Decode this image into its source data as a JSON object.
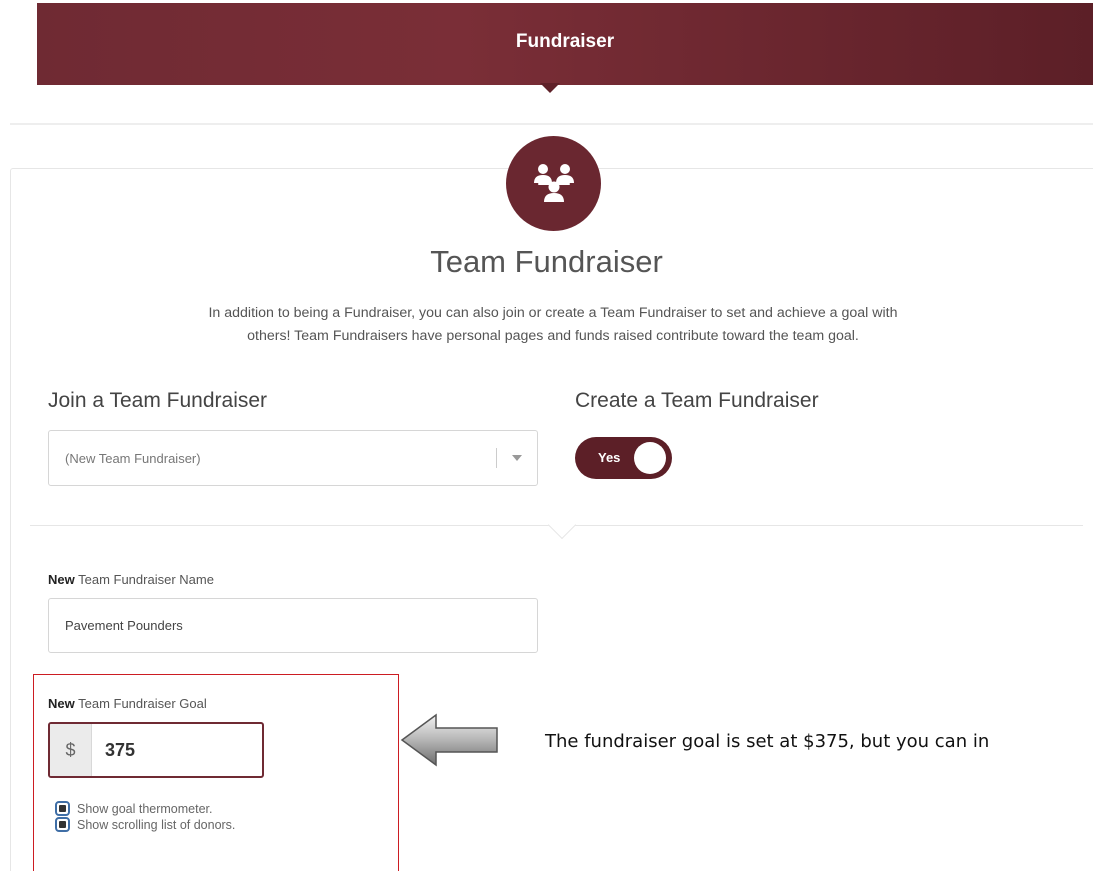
{
  "header": {
    "title": "Fundraiser"
  },
  "team": {
    "icon": "team-group-icon",
    "title": "Team Fundraiser",
    "intro_line1": "In addition to being a Fundraiser, you can also join or create a Team Fundraiser to set and achieve a goal with",
    "intro_line2": "others! Team Fundraisers have personal pages and funds raised contribute toward the team goal."
  },
  "join": {
    "heading": "Join a Team Fundraiser",
    "select_value": "(New Team Fundraiser)"
  },
  "create": {
    "heading": "Create a Team Fundraiser",
    "toggle_label": "Yes"
  },
  "name_field": {
    "label_bold": "New",
    "label_rest": " Team Fundraiser Name",
    "value": "Pavement Pounders"
  },
  "goal_field": {
    "label_bold": "New",
    "label_rest": " Team Fundraiser Goal",
    "prefix": "$",
    "value": "375"
  },
  "options": [
    {
      "label": "Show goal thermometer."
    },
    {
      "label": "Show scrolling list of donors."
    }
  ],
  "annotation": {
    "callout": "The fundraiser goal is set at $375, but you can in"
  },
  "colors": {
    "brand": "#6f2a33",
    "highlight": "#cc1c22",
    "checkbox": "#3f6ea6"
  }
}
